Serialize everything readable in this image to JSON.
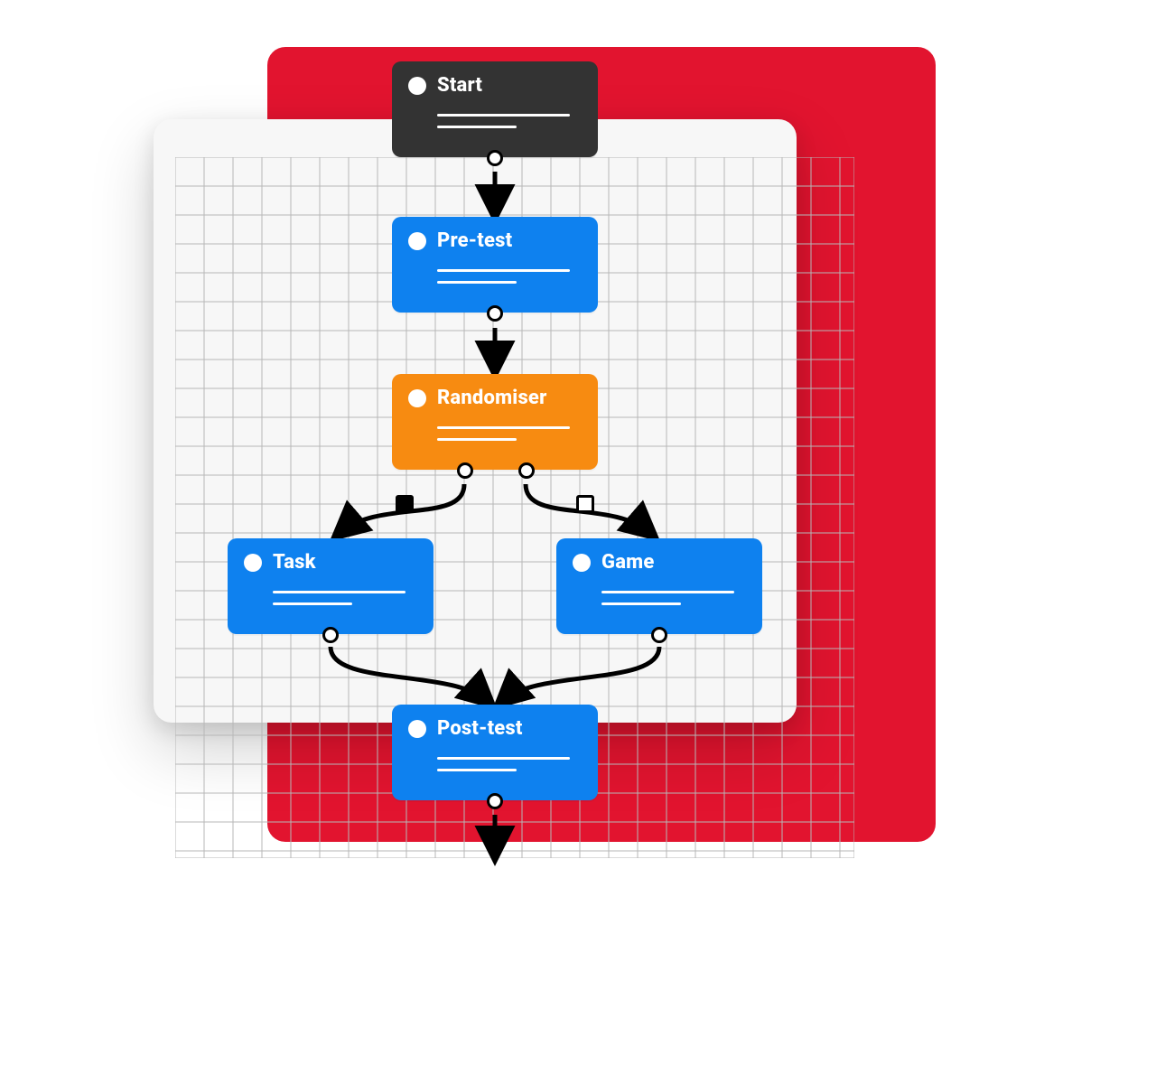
{
  "colors": {
    "red": "#e2142f",
    "white_card": "#f7f7f7",
    "dark": "#333333",
    "blue": "#0e81ef",
    "orange": "#f78b11"
  },
  "nodes": {
    "start": {
      "label": "Start"
    },
    "pretest": {
      "label": "Pre-test"
    },
    "randomiser": {
      "label": "Randomiser"
    },
    "task": {
      "label": "Task"
    },
    "game": {
      "label": "Game"
    },
    "posttest": {
      "label": "Post-test"
    }
  }
}
